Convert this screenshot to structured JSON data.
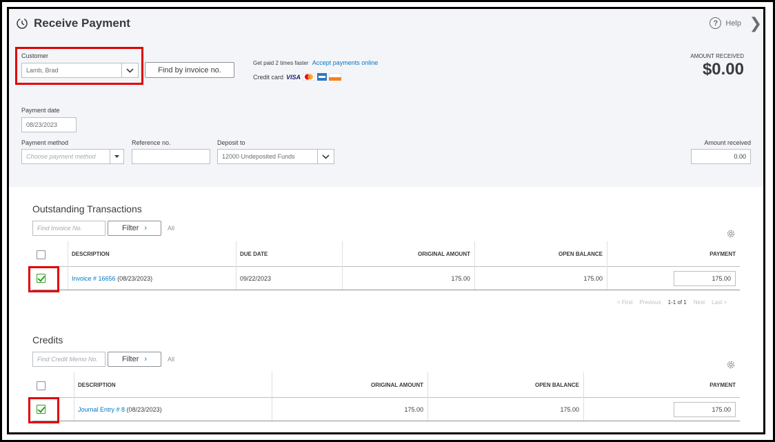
{
  "header": {
    "title": "Receive Payment",
    "help_label": "Help",
    "close_glyph": "❯"
  },
  "customer": {
    "label": "Customer",
    "value": "Lamb, Brad",
    "find_button": "Find by invoice no."
  },
  "promo": {
    "line1": "Get paid 2 times faster",
    "link": "Accept payments online",
    "credit_label": "Credit card",
    "cards": [
      "visa-icon",
      "mastercard-icon",
      "amex-icon",
      "discover-icon"
    ]
  },
  "amount_received": {
    "label": "AMOUNT RECEIVED",
    "value": "$0.00",
    "field_label": "Amount received",
    "field_value": "0.00"
  },
  "payment_date": {
    "label": "Payment date",
    "value": "08/23/2023"
  },
  "payment_method": {
    "label": "Payment method",
    "placeholder": "Choose payment method"
  },
  "reference": {
    "label": "Reference no.",
    "value": ""
  },
  "deposit": {
    "label": "Deposit to",
    "value": "12000 Undeposited Funds"
  },
  "outstanding": {
    "title": "Outstanding Transactions",
    "search_placeholder": "Find Invoice No.",
    "filter_label": "Filter",
    "all_label": "All",
    "columns": [
      "DESCRIPTION",
      "DUE DATE",
      "ORIGINAL AMOUNT",
      "OPEN BALANCE",
      "PAYMENT"
    ],
    "rows": [
      {
        "desc_link": "Invoice # 16656",
        "desc_date": "(08/23/2023)",
        "due": "09/22/2023",
        "original": "175.00",
        "open": "175.00",
        "payment": "175.00",
        "checked": true
      }
    ],
    "pager": {
      "first": "< First",
      "previous": "Previous",
      "range": "1-1 of 1",
      "next": "Next",
      "last": "Last >"
    }
  },
  "credits": {
    "title": "Credits",
    "search_placeholder": "Find Credit Memo No.",
    "filter_label": "Filter",
    "all_label": "All",
    "columns": [
      "DESCRIPTION",
      "ORIGINAL AMOUNT",
      "OPEN BALANCE",
      "PAYMENT"
    ],
    "rows": [
      {
        "desc_link": "Journal Entry # 8",
        "desc_date": "(08/23/2023)",
        "original": "175.00",
        "open": "175.00",
        "payment": "175.00",
        "checked": true
      }
    ]
  },
  "colors": {
    "highlight": "#e00000",
    "link": "#0077c5",
    "check": "#2ca01c",
    "panel": "#f4f5f8"
  }
}
